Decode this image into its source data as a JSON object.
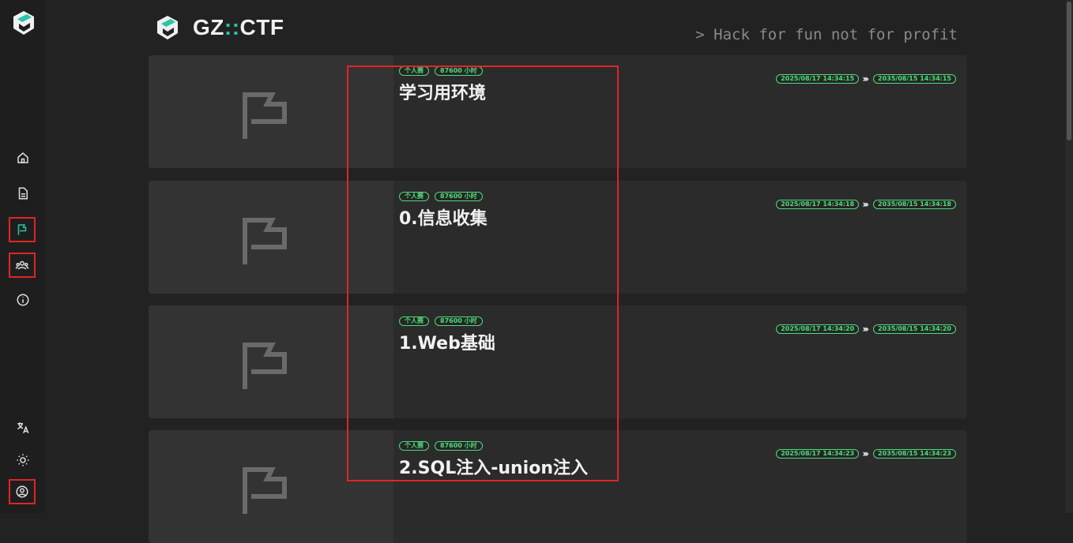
{
  "brand": {
    "name_left": "GZ",
    "separator": "::",
    "name_right": "CTF",
    "slogan": "> Hack for fun not for profit"
  },
  "colors": {
    "accent": "#2bc4a6",
    "tag": "#4ddb7a",
    "highlight": "#e02424",
    "background": "#222222"
  },
  "sidebar": {
    "items": [
      {
        "icon": "home-icon"
      },
      {
        "icon": "document-icon"
      },
      {
        "icon": "flag-icon",
        "active": true
      },
      {
        "icon": "users-icon"
      },
      {
        "icon": "info-icon"
      },
      {
        "icon": "translate-icon"
      },
      {
        "icon": "sun-icon"
      },
      {
        "icon": "user-circle-icon"
      }
    ]
  },
  "games": [
    {
      "mode": "个人赛",
      "duration": "87600 小时",
      "title": "学习用环境",
      "start": "2025/08/17 14:34:15",
      "end": "2035/08/15 14:34:15"
    },
    {
      "mode": "个人赛",
      "duration": "87600 小时",
      "title": "0.信息收集",
      "start": "2025/08/17 14:34:18",
      "end": "2035/08/15 14:34:18"
    },
    {
      "mode": "个人赛",
      "duration": "87600 小时",
      "title": "1.Web基础",
      "start": "2025/08/17 14:34:20",
      "end": "2035/08/15 14:34:20"
    },
    {
      "mode": "个人赛",
      "duration": "87600 小时",
      "title": "2.SQL注入-union注入",
      "start": "2025/08/17 14:34:23",
      "end": "2035/08/15 14:34:23"
    }
  ]
}
